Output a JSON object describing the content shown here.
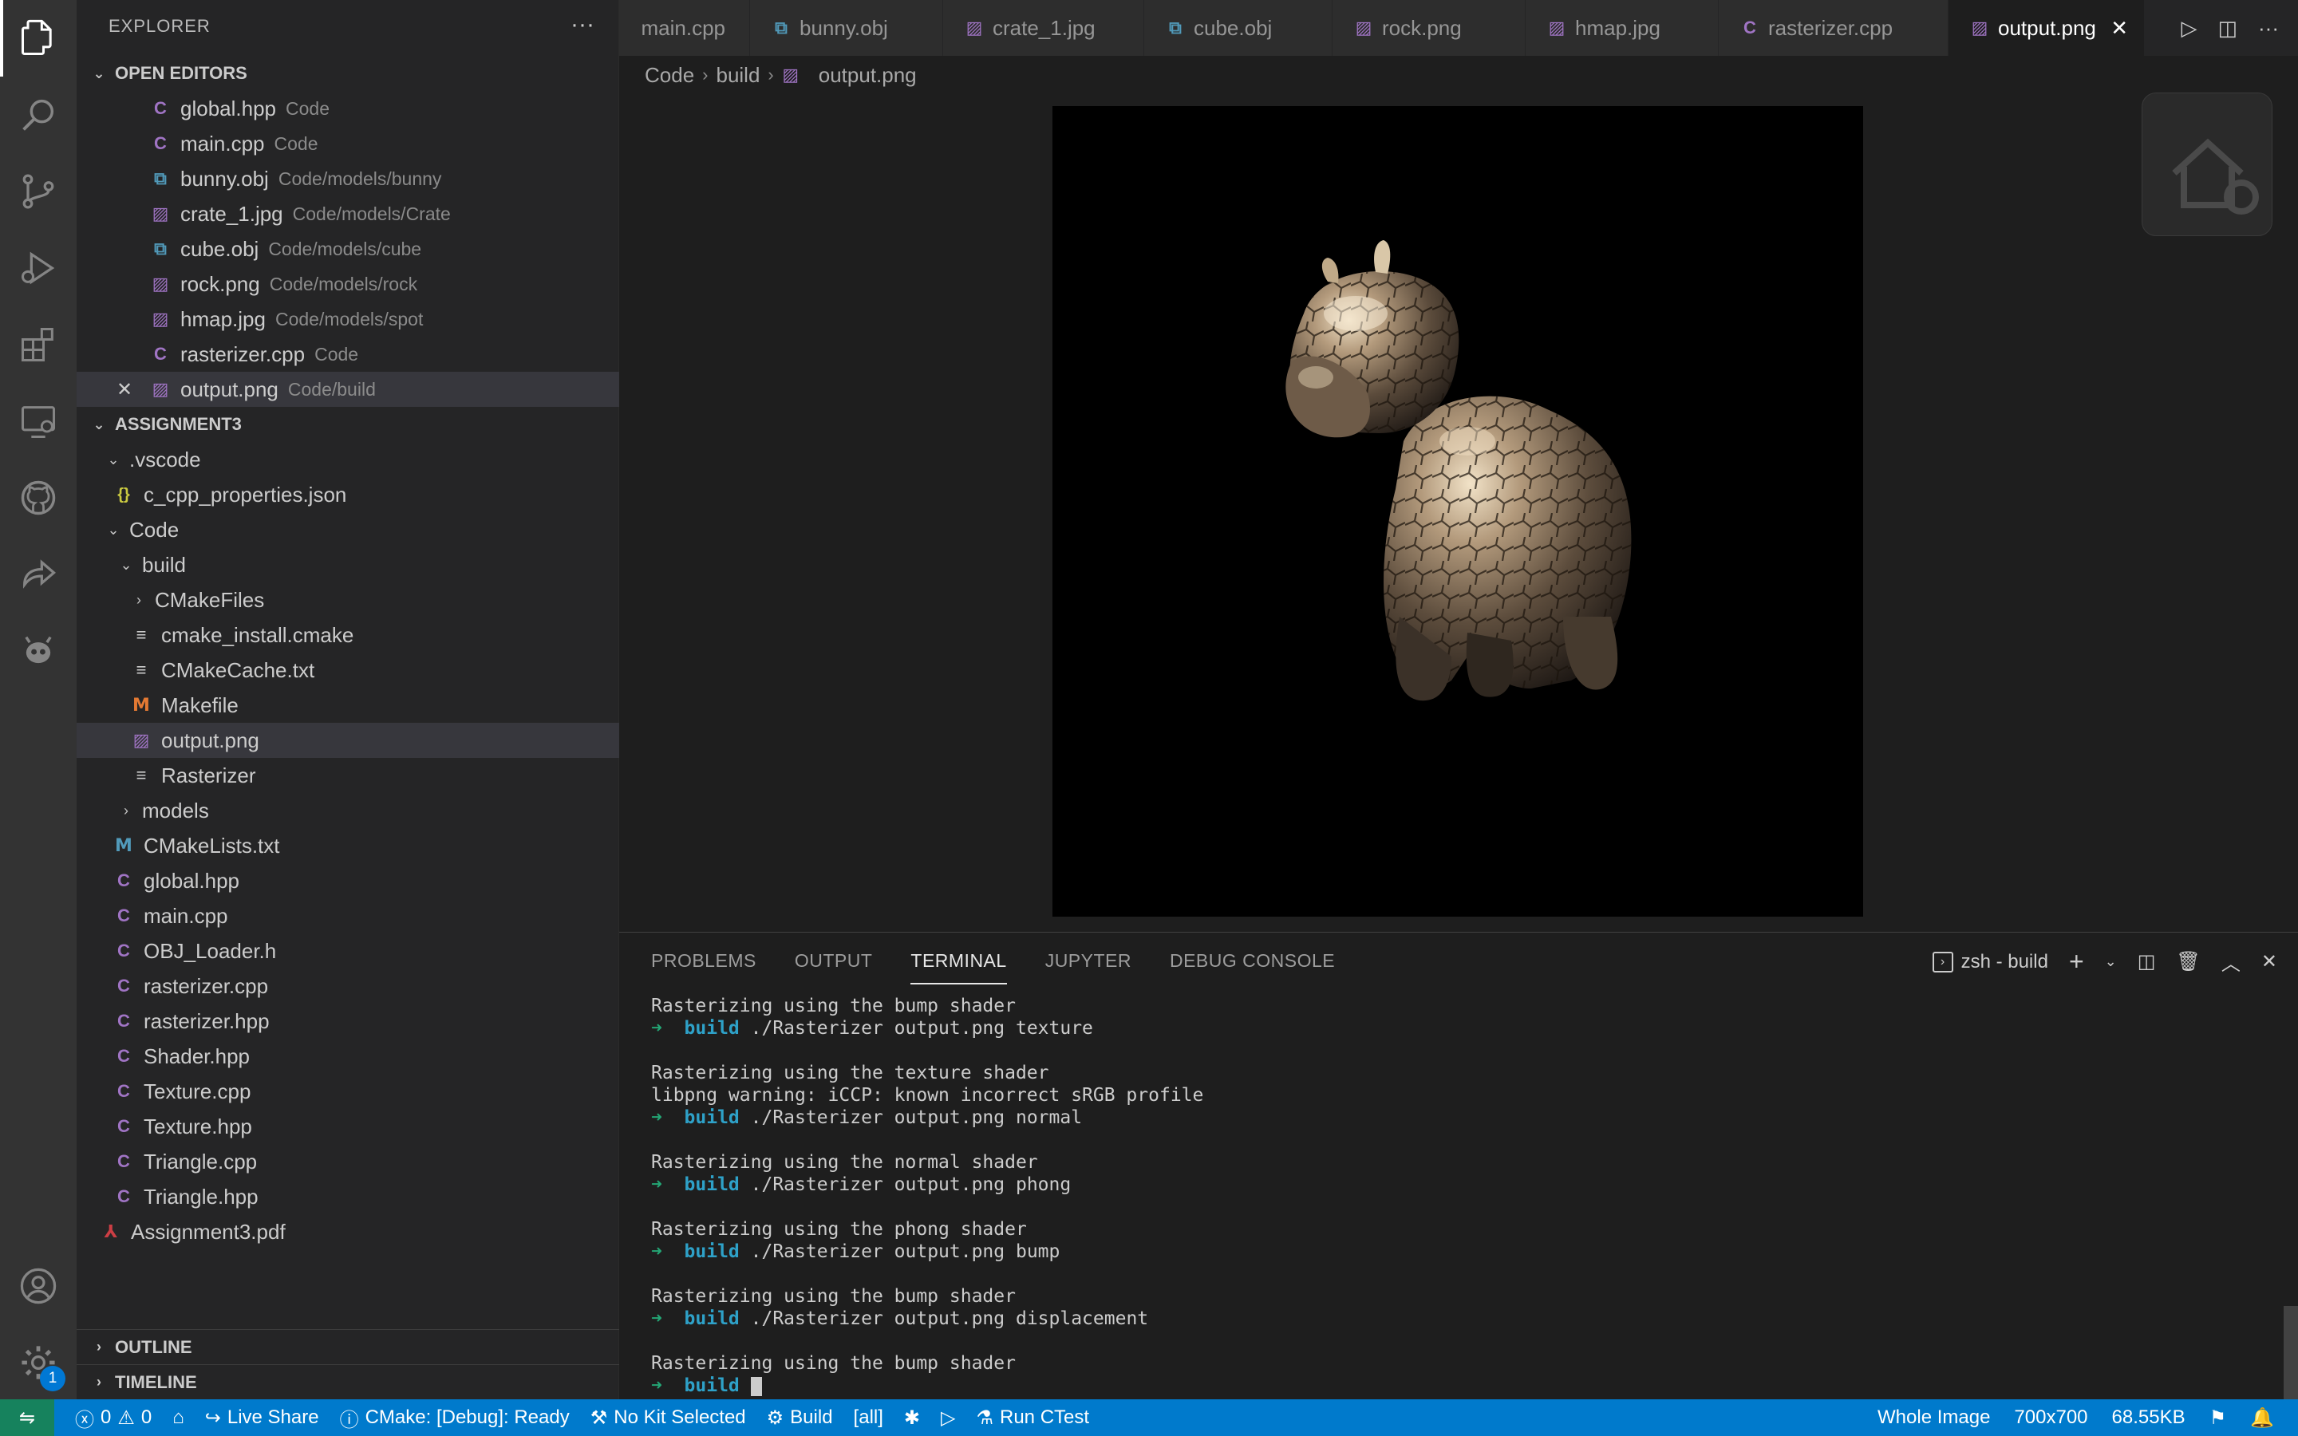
{
  "sidebar": {
    "title": "EXPLORER",
    "open_editors_label": "OPEN EDITORS",
    "open_editors": [
      {
        "name": "global.hpp",
        "desc": "Code",
        "icon": "cpp-icon"
      },
      {
        "name": "main.cpp",
        "desc": "Code",
        "icon": "cpp-icon"
      },
      {
        "name": "bunny.obj",
        "desc": "Code/models/bunny",
        "icon": "obj-icon"
      },
      {
        "name": "crate_1.jpg",
        "desc": "Code/models/Crate",
        "icon": "image-icon"
      },
      {
        "name": "cube.obj",
        "desc": "Code/models/cube",
        "icon": "obj-icon"
      },
      {
        "name": "rock.png",
        "desc": "Code/models/rock",
        "icon": "image-icon"
      },
      {
        "name": "hmap.jpg",
        "desc": "Code/models/spot",
        "icon": "image-icon"
      },
      {
        "name": "rasterizer.cpp",
        "desc": "Code",
        "icon": "cpp-icon"
      },
      {
        "name": "output.png",
        "desc": "Code/build",
        "icon": "image-icon"
      }
    ],
    "project_label": "ASSIGNMENT3",
    "tree": [
      {
        "name": ".vscode"
      },
      {
        "name": "c_cpp_properties.json"
      },
      {
        "name": "Code"
      },
      {
        "name": "build"
      },
      {
        "name": "CMakeFiles"
      },
      {
        "name": "cmake_install.cmake"
      },
      {
        "name": "CMakeCache.txt"
      },
      {
        "name": "Makefile"
      },
      {
        "name": "output.png"
      },
      {
        "name": "Rasterizer"
      },
      {
        "name": "models"
      },
      {
        "name": "CMakeLists.txt"
      },
      {
        "name": "global.hpp"
      },
      {
        "name": "main.cpp"
      },
      {
        "name": "OBJ_Loader.h"
      },
      {
        "name": "rasterizer.cpp"
      },
      {
        "name": "rasterizer.hpp"
      },
      {
        "name": "Shader.hpp"
      },
      {
        "name": "Texture.cpp"
      },
      {
        "name": "Texture.hpp"
      },
      {
        "name": "Triangle.cpp"
      },
      {
        "name": "Triangle.hpp"
      },
      {
        "name": "Assignment3.pdf"
      }
    ],
    "outline_label": "OUTLINE",
    "timeline_label": "TIMELINE"
  },
  "tabs": [
    {
      "label": "main.cpp",
      "icon": "cpp-icon"
    },
    {
      "label": "bunny.obj",
      "icon": "obj-icon"
    },
    {
      "label": "crate_1.jpg",
      "icon": "image-icon"
    },
    {
      "label": "cube.obj",
      "icon": "obj-icon"
    },
    {
      "label": "rock.png",
      "icon": "image-icon"
    },
    {
      "label": "hmap.jpg",
      "icon": "image-icon"
    },
    {
      "label": "rasterizer.cpp",
      "icon": "cpp-icon"
    },
    {
      "label": "output.png",
      "icon": "image-icon"
    }
  ],
  "breadcrumb": [
    "Code",
    "build",
    "output.png"
  ],
  "panel": {
    "tabs": [
      "PROBLEMS",
      "OUTPUT",
      "TERMINAL",
      "JUPYTER",
      "DEBUG CONSOLE"
    ],
    "active_tab": "TERMINAL",
    "terminal_name": "zsh - build",
    "prompt_arrow": "➜",
    "prompt_dir": "build",
    "lines": [
      {
        "text": "Rasterizing using the bump shader"
      },
      {
        "cmd": "./Rasterizer output.png texture"
      },
      {
        "text": ""
      },
      {
        "text": "Rasterizing using the texture shader"
      },
      {
        "text": "libpng warning: iCCP: known incorrect sRGB profile"
      },
      {
        "cmd": "./Rasterizer output.png normal"
      },
      {
        "text": ""
      },
      {
        "text": "Rasterizing using the normal shader"
      },
      {
        "cmd": "./Rasterizer output.png phong"
      },
      {
        "text": ""
      },
      {
        "text": "Rasterizing using the phong shader"
      },
      {
        "cmd": "./Rasterizer output.png bump"
      },
      {
        "text": ""
      },
      {
        "text": "Rasterizing using the bump shader"
      },
      {
        "cmd": "./Rasterizer output.png displacement"
      },
      {
        "text": ""
      },
      {
        "text": "Rasterizing using the bump shader"
      },
      {
        "cmd": "",
        "cursor": true
      }
    ]
  },
  "status": {
    "errors": "0",
    "warnings": "0",
    "live_share": "Live Share",
    "cmake": "CMake: [Debug]: Ready",
    "kit": "No Kit Selected",
    "build": "Build",
    "target": "[all]",
    "ctest": "Run CTest",
    "view_mode": "Whole Image",
    "dimensions": "700x700",
    "file_size": "68.55KB"
  },
  "activity_badge": "1",
  "colors": {
    "accent": "#007acc",
    "remote": "#16825d",
    "prompt_arrow": "#24a675",
    "prompt_dir": "#2ea1c8"
  }
}
